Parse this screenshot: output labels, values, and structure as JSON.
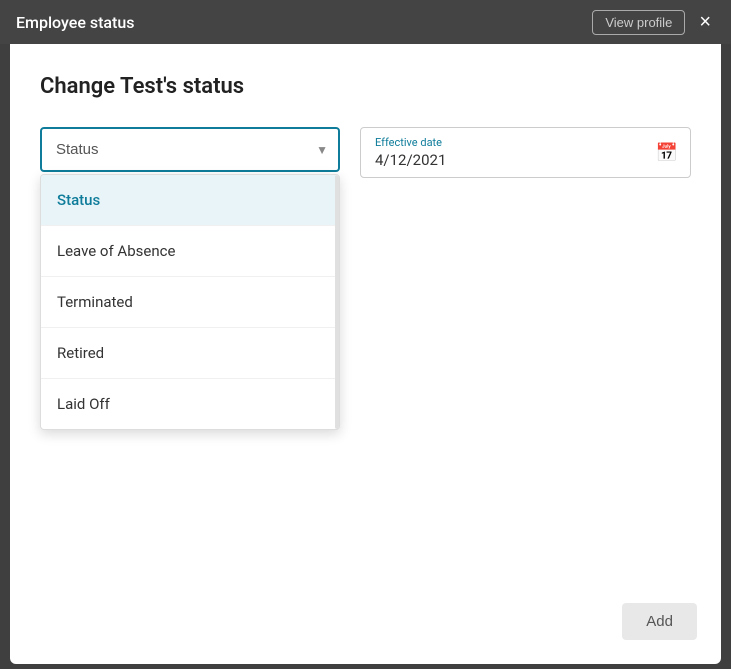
{
  "header": {
    "title": "Employee status",
    "view_profile_label": "View profile",
    "close_label": "×"
  },
  "modal": {
    "title": "Change Test's status",
    "status_placeholder": "Status",
    "effective_date_label": "Effective date",
    "effective_date_value": "4/12/2021",
    "add_button_label": "Add"
  },
  "dropdown": {
    "options": [
      {
        "label": "Status",
        "value": "status",
        "selected": true
      },
      {
        "label": "Leave of Absence",
        "value": "leave_of_absence",
        "selected": false
      },
      {
        "label": "Terminated",
        "value": "terminated",
        "selected": false
      },
      {
        "label": "Retired",
        "value": "retired",
        "selected": false
      },
      {
        "label": "Laid Off",
        "value": "laid_off",
        "selected": false
      }
    ]
  }
}
